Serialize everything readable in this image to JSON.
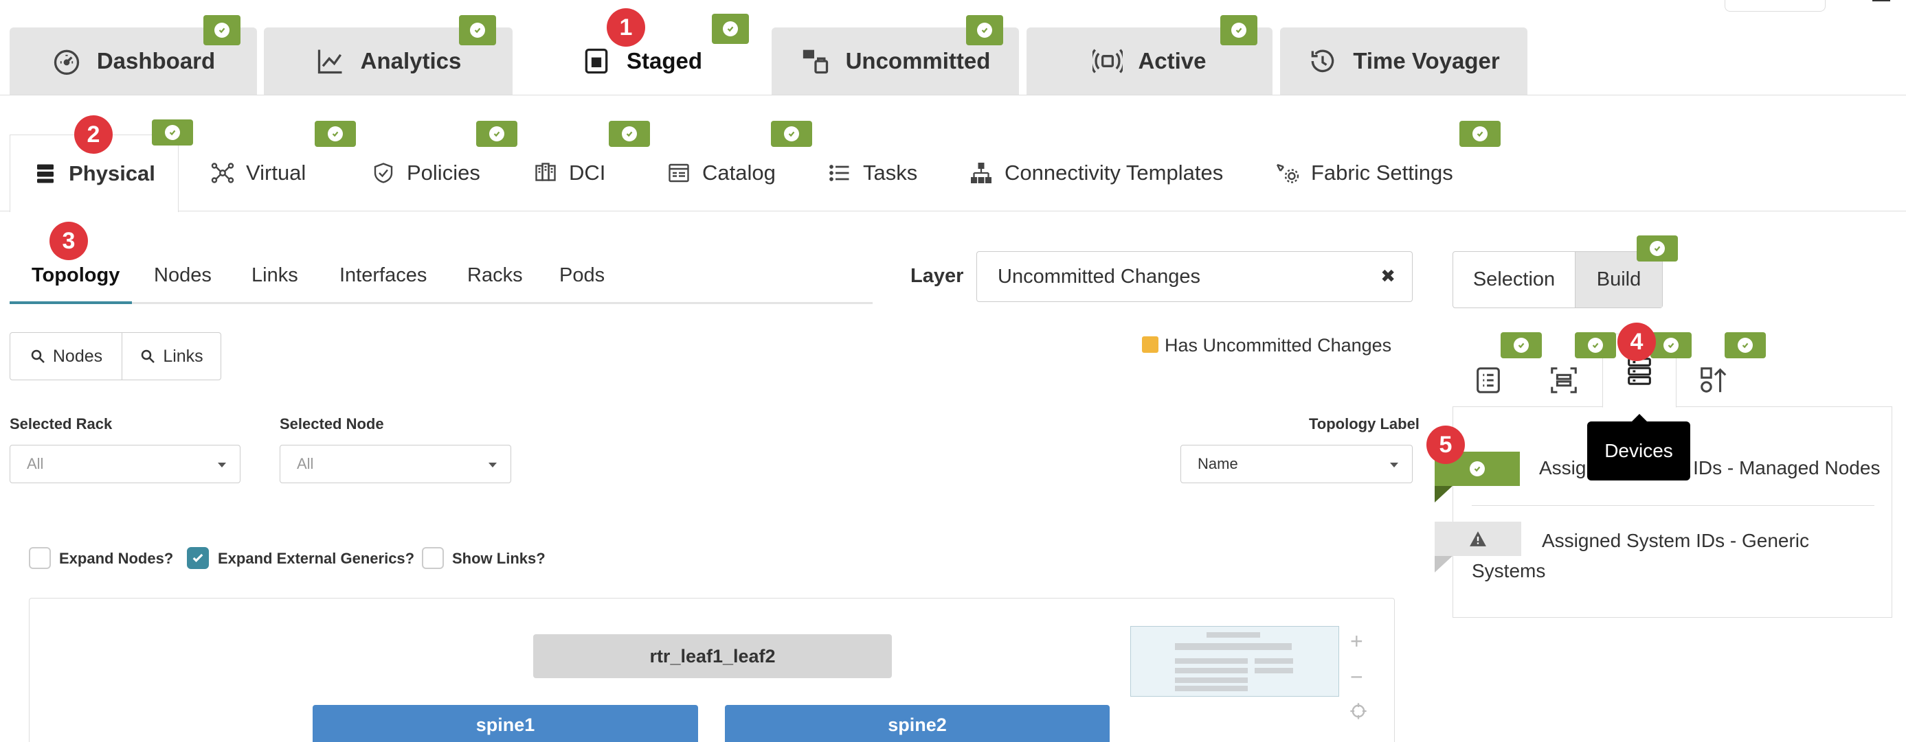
{
  "top_tabs": [
    {
      "label": "Dashboard"
    },
    {
      "label": "Analytics"
    },
    {
      "label": "Staged"
    },
    {
      "label": "Uncommitted"
    },
    {
      "label": "Active"
    },
    {
      "label": "Time Voyager"
    }
  ],
  "sub_tabs": [
    {
      "label": "Physical"
    },
    {
      "label": "Virtual"
    },
    {
      "label": "Policies"
    },
    {
      "label": "DCI"
    },
    {
      "label": "Catalog"
    },
    {
      "label": "Tasks"
    },
    {
      "label": "Connectivity Templates"
    },
    {
      "label": "Fabric Settings"
    }
  ],
  "markers": [
    "1",
    "2",
    "3",
    "4",
    "5"
  ],
  "layout_tabs": [
    {
      "label": "Topology"
    },
    {
      "label": "Nodes"
    },
    {
      "label": "Links"
    },
    {
      "label": "Interfaces"
    },
    {
      "label": "Racks"
    },
    {
      "label": "Pods"
    }
  ],
  "layer": {
    "label": "Layer",
    "value": "Uncommitted Changes",
    "clear": "✖"
  },
  "search_buttons": {
    "nodes": "Nodes",
    "links": "Links"
  },
  "legend": {
    "label": "Has Uncommitted Changes",
    "color": "#f2b63c"
  },
  "filters": {
    "selected_rack": {
      "label": "Selected Rack",
      "value": "All"
    },
    "selected_node": {
      "label": "Selected Node",
      "value": "All"
    },
    "topology_label": {
      "label": "Topology Label",
      "value": "Name"
    }
  },
  "options": {
    "expand_nodes": {
      "label": "Expand Nodes?",
      "checked": false
    },
    "expand_external": {
      "label": "Expand External Generics?",
      "checked": true
    },
    "show_links": {
      "label": "Show Links?",
      "checked": false
    }
  },
  "topology": {
    "group": "rtr_leaf1_leaf2",
    "nodes": [
      "spine1",
      "spine2"
    ],
    "zoom": {
      "in": "+",
      "out": "−"
    }
  },
  "right_panel": {
    "mode_tabs": {
      "selection": "Selection",
      "build": "Build"
    },
    "tooltip": "Devices",
    "items": [
      {
        "label": "Assigned System IDs - Managed Nodes",
        "status": "ok"
      },
      {
        "label": "Assigned System IDs - Generic Systems",
        "status": "warning"
      }
    ]
  },
  "colors": {
    "accent_green": "#7ba23f",
    "badge_red": "#e0363c",
    "node_blue": "#4a88c9"
  }
}
